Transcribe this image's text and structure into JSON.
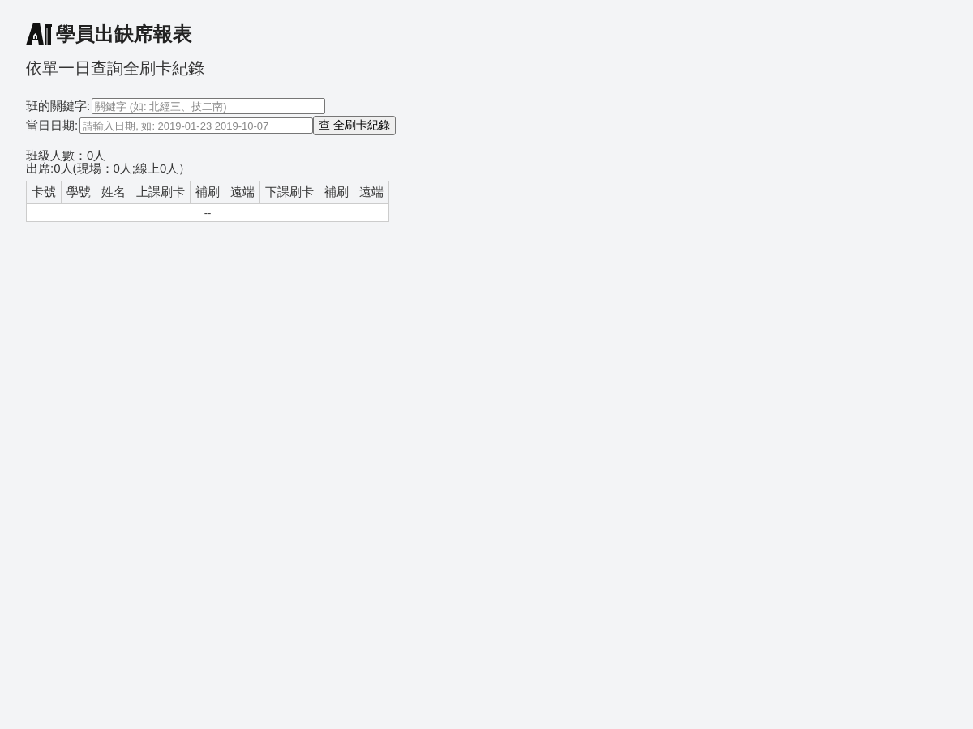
{
  "header": {
    "title": "學員出缺席報表"
  },
  "subtitle": "依單一日查詢全刷卡紀錄",
  "form": {
    "fields": [
      {
        "label": "班的關鍵字:",
        "placeholder": "關鍵字 (如: 北經三、技二南)"
      },
      {
        "label": "當日日期:",
        "placeholder": "請輸入日期, 如: 2019-01-23 2019-10-07",
        "button": "查 全刷卡紀錄"
      }
    ]
  },
  "summary": [
    "班級人數：0人",
    "出席:0人(現場：0人;線上0人）"
  ],
  "table": {
    "columns": [
      "卡號",
      "學號",
      "姓名",
      "上課刷卡",
      "補刷",
      "遠端",
      "下課刷卡",
      "補刷",
      "遠端"
    ],
    "rows": [
      {
        "kind": "empty",
        "text": "--"
      }
    ]
  }
}
